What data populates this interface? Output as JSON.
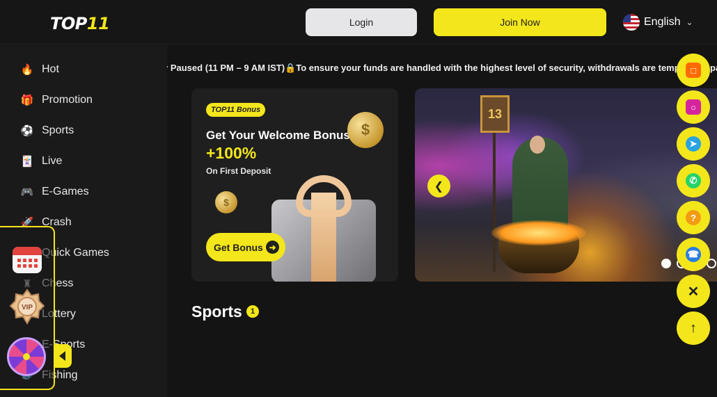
{
  "header": {
    "logo_text": "TOP",
    "logo_accent": "11",
    "login_label": "Login",
    "join_label": "Join Now",
    "language": "English"
  },
  "sidebar": {
    "items": [
      {
        "label": "Hot",
        "icon": "flame-icon"
      },
      {
        "label": "Promotion",
        "icon": "gift-icon"
      },
      {
        "label": "Sports",
        "icon": "sports-icon"
      },
      {
        "label": "Live",
        "icon": "cards-icon"
      },
      {
        "label": "E-Games",
        "icon": "gamepad-icon"
      },
      {
        "label": "Crash",
        "icon": "rocket-icon"
      },
      {
        "label": "Quick Games",
        "icon": "dice-icon"
      },
      {
        "label": "Chess",
        "icon": "chess-icon"
      },
      {
        "label": "Lottery",
        "icon": "lottery-icon"
      },
      {
        "label": "E-Sports",
        "icon": "esports-icon"
      },
      {
        "label": "Fishing",
        "icon": "fish-icon"
      }
    ]
  },
  "float_panel": {
    "vip_label": "VIP"
  },
  "marquee": {
    "text": "y Paused (11 PM – 9 AM IST)🔒To ensure your funds are handled with the highest level of security, withdrawals are temporarily paus"
  },
  "bonus_card": {
    "tag": "TOP11 Bonus",
    "title": "Get Your Welcome Bonus",
    "percent": "+100%",
    "subtitle": "On First Deposit",
    "button": "Get Bonus"
  },
  "banner": {
    "sign_text": "13",
    "active_slide_index": 0,
    "slide_count": 3
  },
  "sports_section": {
    "title": "Sports",
    "count": "1"
  },
  "float_buttons": [
    {
      "icon": "chat-icon",
      "color": "#ff6a00"
    },
    {
      "icon": "instagram-icon",
      "color": "#d6249f"
    },
    {
      "icon": "telegram-icon",
      "color": "#2aa3e0"
    },
    {
      "icon": "whatsapp-icon",
      "color": "#25d366"
    },
    {
      "icon": "help-icon",
      "color": "#f39c12"
    },
    {
      "icon": "phone-icon",
      "color": "#2a7de1"
    },
    {
      "icon": "close-icon",
      "color": "#222222"
    },
    {
      "icon": "arrow-up-icon",
      "color": "#222222"
    }
  ],
  "colors": {
    "accent": "#f3e61b",
    "background": "#141414",
    "sidebar": "#1a1a1a"
  }
}
